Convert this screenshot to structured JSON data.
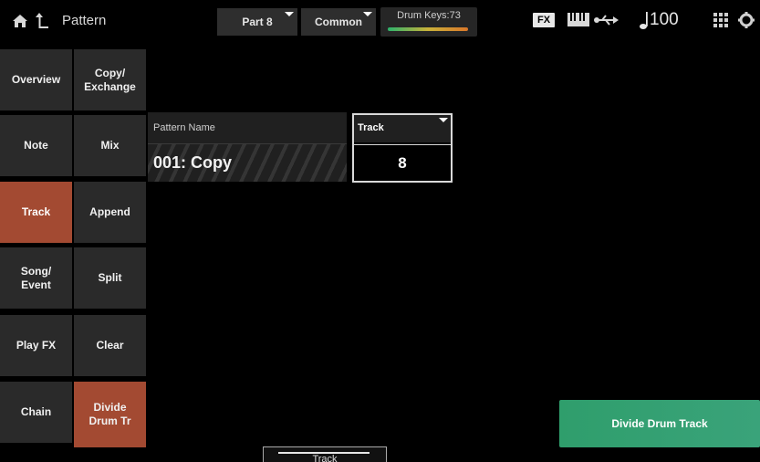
{
  "header": {
    "title": "Pattern",
    "part_label": "Part 8",
    "common_label": "Common",
    "drum_keys_label": "Drum Keys:73",
    "fx_label": "FX",
    "tempo": "100"
  },
  "left_tabs": [
    {
      "label": "Overview",
      "active": false
    },
    {
      "label": "Note",
      "active": false
    },
    {
      "label": "Track",
      "active": true
    },
    {
      "label": "Song/ Event",
      "active": false
    },
    {
      "label": "Play FX",
      "active": false
    },
    {
      "label": "Chain",
      "active": false
    }
  ],
  "sub_tabs": [
    {
      "label": "Copy/ Exchange",
      "active": false
    },
    {
      "label": "Mix",
      "active": false
    },
    {
      "label": "Append",
      "active": false
    },
    {
      "label": "Split",
      "active": false
    },
    {
      "label": "Clear",
      "active": false
    },
    {
      "label": "Divide Drum Tr",
      "active": true
    }
  ],
  "pattern_name": {
    "label": "Pattern Name",
    "value": "001: Copy"
  },
  "track": {
    "label": "Track",
    "value": "8"
  },
  "action_button": "Divide Drum Track",
  "bottom_tab": "Track",
  "colors": {
    "accent": "#a34a32",
    "action": "#2f9e6c",
    "tab_bg": "#2a2a2a"
  }
}
